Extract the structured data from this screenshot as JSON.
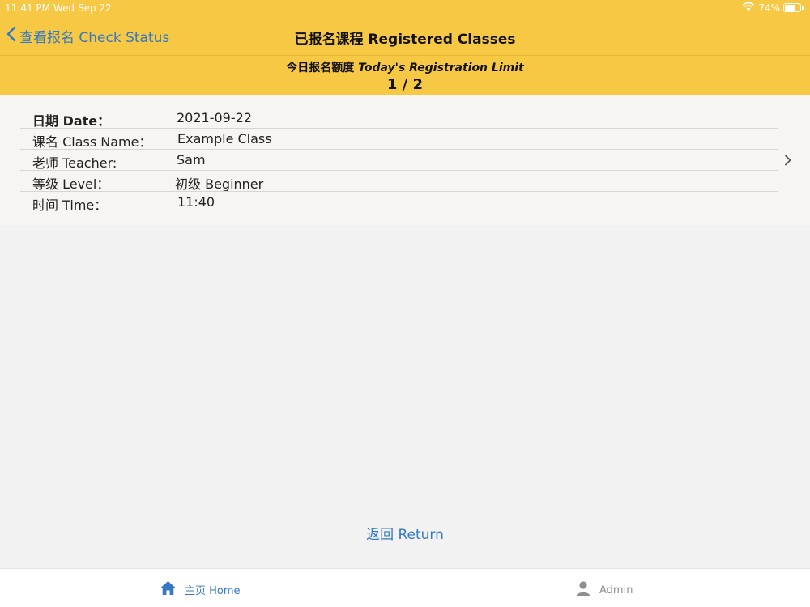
{
  "status_bar": {
    "time": "11:41 PM",
    "date": "Wed Sep 22",
    "battery": "74%",
    "battery_level": 0.74
  },
  "nav": {
    "back_label": "查看报名 Check Status",
    "title": "已报名课程 Registered Classes"
  },
  "limit": {
    "label_zh": "今日报名额度",
    "label_en": "Today's Registration Limit",
    "value": "1 / 2"
  },
  "class_card": {
    "rows": [
      {
        "label": "日期 Date：",
        "value": "2021-09-22"
      },
      {
        "label": "课名 Class Name：",
        "value": "Example Class"
      },
      {
        "label": "老师 Teacher:",
        "value": "Sam"
      },
      {
        "label": "等级 Level：",
        "value": "初级 Beginner"
      },
      {
        "label": "时间 Time：",
        "value": "11:40"
      }
    ]
  },
  "return_label": "返回 Return",
  "tabs": [
    {
      "label": "主页 Home",
      "icon": "home-icon"
    },
    {
      "label": "Admin",
      "icon": "person-icon"
    }
  ],
  "colors": {
    "header_yellow": "#f7c844",
    "accent_blue": "#3478c6",
    "inactive_gray": "#8e8e93"
  }
}
